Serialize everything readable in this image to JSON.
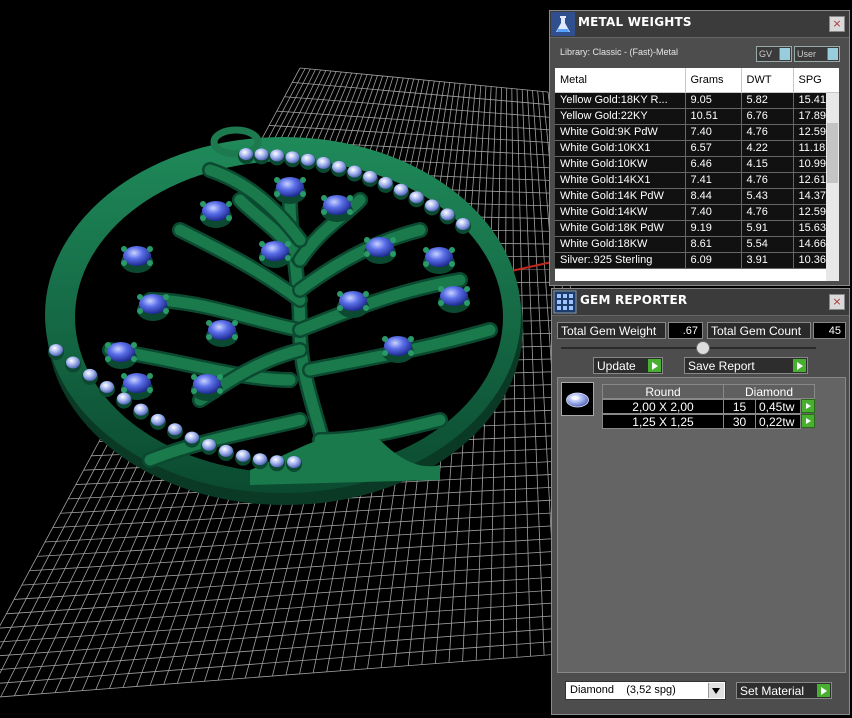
{
  "metal_weights": {
    "title": "METAL WEIGHTS",
    "library": "Library: Classic - (Fast)-Metal",
    "toggle_gv": "GV",
    "toggle_user": "User",
    "columns": [
      "Metal",
      "Grams",
      "DWT",
      "SPG"
    ],
    "rows": [
      [
        "Yellow Gold:18KY R...",
        "9.05",
        "5.82",
        "15.41"
      ],
      [
        "Yellow Gold:22KY",
        "10.51",
        "6.76",
        "17.89"
      ],
      [
        "White Gold:9K PdW",
        "7.40",
        "4.76",
        "12.59"
      ],
      [
        "White Gold:10KX1",
        "6.57",
        "4.22",
        "11.18"
      ],
      [
        "White Gold:10KW",
        "6.46",
        "4.15",
        "10.99"
      ],
      [
        "White Gold:14KX1",
        "7.41",
        "4.76",
        "12.61"
      ],
      [
        "White Gold:14K PdW",
        "8.44",
        "5.43",
        "14.37"
      ],
      [
        "White Gold:14KW",
        "7.40",
        "4.76",
        "12.59"
      ],
      [
        "White Gold:18K PdW",
        "9.19",
        "5.91",
        "15.63"
      ],
      [
        "White Gold:18KW",
        "8.61",
        "5.54",
        "14.66"
      ],
      [
        "Silver:.925 Sterling",
        "6.09",
        "3.91",
        "10.36"
      ]
    ],
    "close": "×"
  },
  "gem_reporter": {
    "title": "GEM REPORTER",
    "close": "×",
    "total_weight_label": "Total Gem Weight",
    "total_weight_value": ".67",
    "total_count_label": "Total Gem Count",
    "total_count_value": "45",
    "update_label": "Update",
    "save_report_label": "Save Report",
    "header_shape": "Round",
    "header_material": "Diamond",
    "gems": [
      {
        "size": "2,00 X 2,00",
        "count": "15",
        "weight": "0,45tw"
      },
      {
        "size": "1,25 X 1,25",
        "count": "30",
        "weight": "0,22tw"
      }
    ],
    "material_select": "Diamond    (3,52 spg)",
    "set_material_label": "Set Material"
  },
  "colors": {
    "pendant_green": "#0f5a3a",
    "gem_blue": "#4a5fd8",
    "accept_green": "#48b030"
  }
}
